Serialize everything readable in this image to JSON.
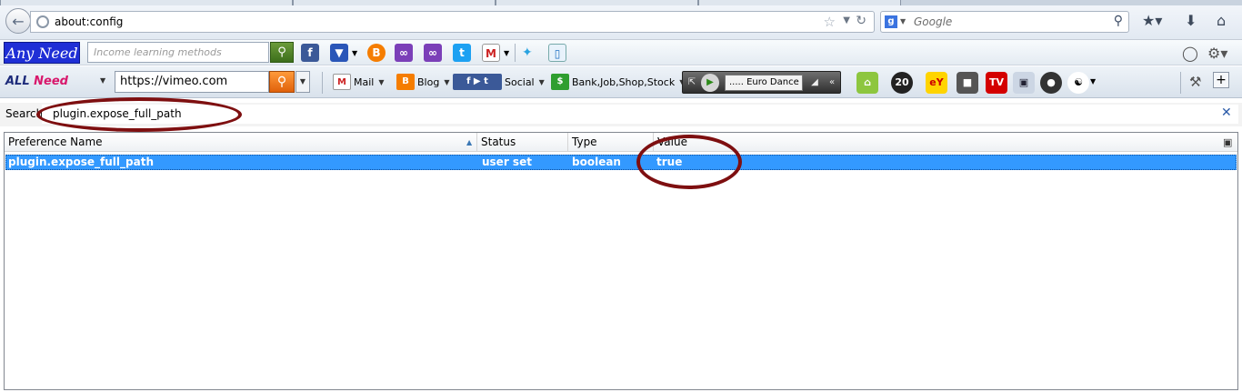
{
  "nav": {
    "url": "about:config",
    "search_placeholder": "Google",
    "search_engine_letter": "g"
  },
  "anyneed_toolbar": {
    "logo": "Any Need",
    "search_placeholder": "Income learning methods"
  },
  "allneed_toolbar": {
    "logo_part1": "ALL",
    "logo_part2": "Need",
    "url_value": "https://vimeo.com",
    "buttons": {
      "mail": "Mail",
      "blog": "Blog",
      "social": "Social",
      "bank": "Bank,Job,Shop,Stock"
    },
    "radio_station": "..... Euro Dance",
    "tv_label": "TV"
  },
  "config": {
    "search_label": "Search:",
    "search_value": "plugin.expose_full_path",
    "columns": [
      "Preference Name",
      "Status",
      "Type",
      "Value"
    ],
    "rows": [
      {
        "name": "plugin.expose_full_path",
        "status": "user set",
        "type": "boolean",
        "value": "true"
      }
    ]
  },
  "colors": {
    "selection": "#3399ff",
    "annotation": "#7e0f10"
  }
}
